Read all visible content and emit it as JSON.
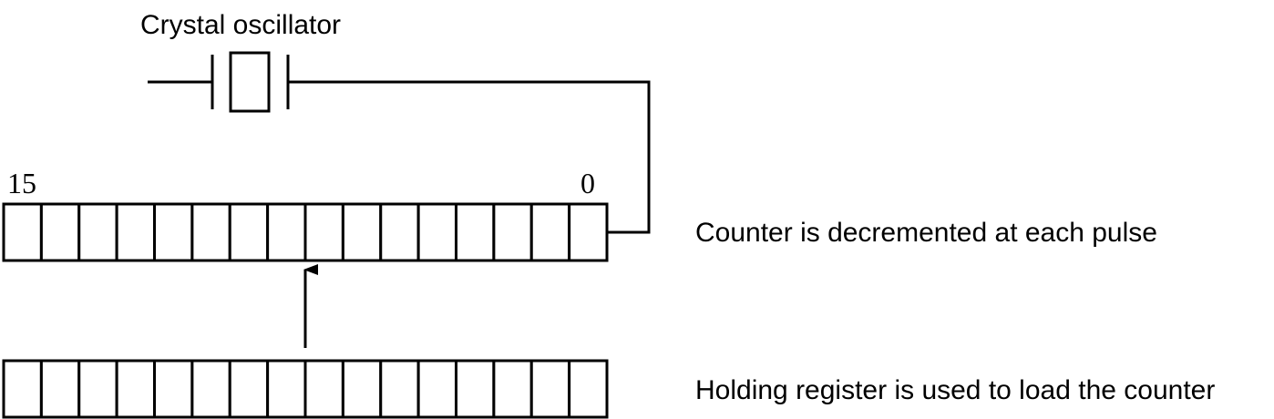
{
  "oscillator": {
    "label": "Crystal oscillator"
  },
  "counter": {
    "high_bit_label": "15",
    "low_bit_label": "0",
    "bit_count": 16,
    "description": "Counter is decremented at each pulse"
  },
  "holding_register": {
    "bit_count": 16,
    "description": "Holding register is used to load the counter"
  }
}
